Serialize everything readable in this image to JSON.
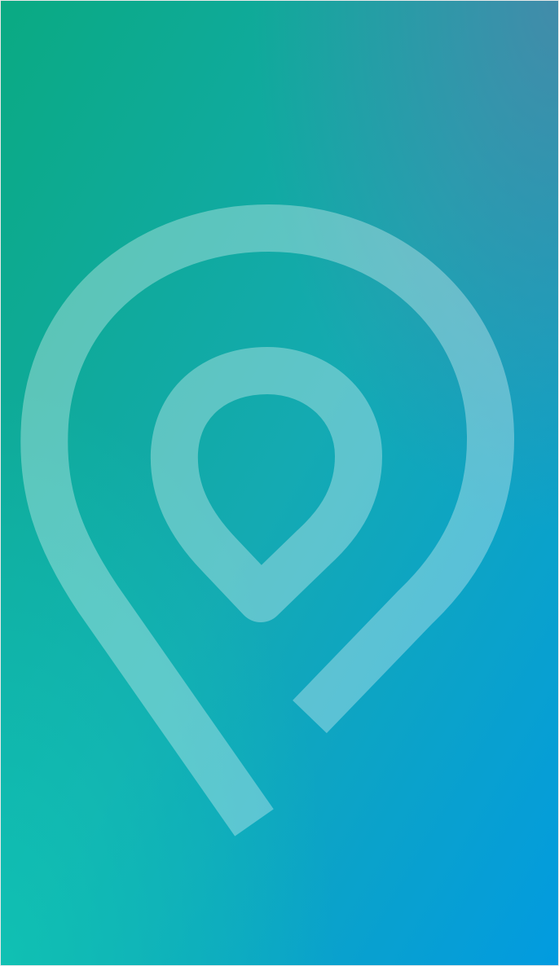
{
  "splash": {
    "background": {
      "gradient_start": "#0aaa82",
      "gradient_mid": "#14aab2",
      "gradient_end": "#029be0",
      "gradient_corner_top_right": "#4a86a8",
      "gradient_corner_bottom_left": "#0fc6b3"
    },
    "logo": {
      "icon": "location-pin-logo-icon",
      "stroke_color": "#ffffff",
      "stroke_opacity": 0.32
    }
  }
}
